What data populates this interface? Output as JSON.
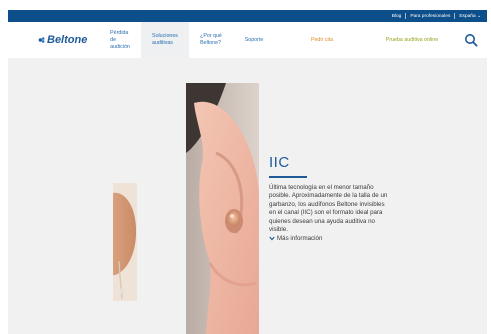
{
  "utility_links": [
    "Blog",
    "Para profesionales",
    "España"
  ],
  "brand": "Beltone",
  "nav": {
    "items": [
      {
        "label": "Pérdida\nde\naudición"
      },
      {
        "label": "Soluciones\nauditivas"
      },
      {
        "label": "¿Por qué\nBeltone?"
      },
      {
        "label": "Soporte"
      }
    ],
    "cta_primary": "Pedir cita",
    "cta_secondary": "Prueba auditiva online"
  },
  "product": {
    "title": "IIC",
    "description": "Última tecnología en el menor tamaño posible. Aproximadamente de la talla de un garbanzo, los audífonos Beltone invisibles en el canal (IIC) son el formato ideal para quienes desean una ayuda auditiva no visible.",
    "more_label": "Más información"
  },
  "colors": {
    "brand_blue": "#1f5a99",
    "topbar_blue": "#0d4f8b",
    "cta_orange": "#e08a1e",
    "cta_green": "#96a21b",
    "page_bg": "#f1f1f1"
  },
  "icons": [
    "beltone-logo-icon",
    "search-icon",
    "chevron-down-icon"
  ]
}
